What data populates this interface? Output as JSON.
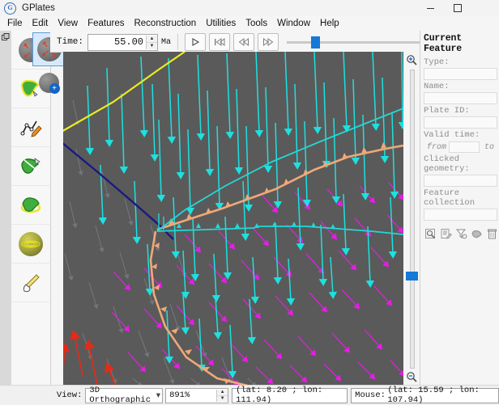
{
  "window": {
    "title": "GPlates",
    "logo_glyph": "G",
    "controls": [
      {
        "name": "minimize-button",
        "label": "–"
      },
      {
        "name": "maximize-button",
        "label": "☐"
      },
      {
        "name": "close-button",
        "label": "✕"
      }
    ]
  },
  "menubar": {
    "items": [
      {
        "label": "File"
      },
      {
        "label": "Edit"
      },
      {
        "label": "View"
      },
      {
        "label": "Features"
      },
      {
        "label": "Reconstruction"
      },
      {
        "label": "Utilities"
      },
      {
        "label": "Tools"
      },
      {
        "label": "Window"
      },
      {
        "label": "Help"
      }
    ]
  },
  "toolbar": {
    "time_label": "Time:",
    "time_value": "55.00",
    "time_unit": "Ma",
    "buttons": [
      {
        "name": "play-button",
        "icon": "play-icon"
      },
      {
        "name": "seek-start-button",
        "icon": "skip-to-start-icon"
      },
      {
        "name": "rewind-button",
        "icon": "rewind-icon"
      },
      {
        "name": "fast-forward-button",
        "icon": "fast-forward-icon"
      }
    ],
    "slider_position_pct": 16
  },
  "left_tools": {
    "dock_handle": "dock-handle-icon",
    "items": [
      {
        "name": "tool-drag-globe",
        "icon": "globe-drag-icon",
        "selected": false
      },
      {
        "name": "tool-digitise-polyline",
        "icon": "green-continent-icon",
        "selected": false
      },
      {
        "name": "tool-move-vertex",
        "icon": "move-vertex-pencil-icon",
        "selected": false
      },
      {
        "name": "tool-split-feature",
        "icon": "split-feature-icon",
        "selected": false
      },
      {
        "name": "tool-manipulate-pole",
        "icon": "manipulate-pole-icon",
        "selected": false
      },
      {
        "name": "tool-measure-distance",
        "icon": "sphere-grid-icon",
        "selected": false
      },
      {
        "name": "tool-lighting",
        "icon": "lighting-torch-icon",
        "selected": false
      }
    ],
    "flyout": [
      {
        "name": "tool-drag-globe-active",
        "icon": "globe-drag-icon",
        "selected": true
      },
      {
        "name": "tool-zoom-globe",
        "icon": "globe-zoom-icon",
        "selected": false
      }
    ]
  },
  "right_panel": {
    "title": "Current Feature",
    "fields": [
      {
        "name": "feature-type",
        "label": "Type:",
        "value": ""
      },
      {
        "name": "feature-name",
        "label": "Name:",
        "value": ""
      },
      {
        "name": "feature-plate-id",
        "label": "Plate ID:",
        "value": ""
      }
    ],
    "valid_time_label": "Valid time:",
    "valid_from_label": "from",
    "valid_to_label": "to",
    "valid_from_value": "",
    "valid_to_value": "",
    "clicked_geometry_label": "Clicked geometry:",
    "clicked_geometry_value": "",
    "feature_collection_label": "Feature collection",
    "feature_collection_value": "",
    "action_icons": [
      {
        "name": "query-feature-icon"
      },
      {
        "name": "edit-feature-icon"
      },
      {
        "name": "clone-feature-icon"
      },
      {
        "name": "copy-geometry-icon"
      },
      {
        "name": "delete-feature-icon"
      }
    ]
  },
  "canvas": {
    "zoom_in_icon": "zoom-in-magnifier-icon",
    "zoom_out_icon": "zoom-out-magnifier-icon",
    "zoom_handle_pct": 68,
    "background_color": "#5a5a5a",
    "velocity_colors": {
      "cyan": "#1ee0e0",
      "magenta": "#e81ce8",
      "grey": "#7b8088",
      "red": "#e32b18"
    },
    "feature_colors": {
      "subduction_orange": "#f0a878",
      "boundary_cyan": "#22d8d8",
      "ridge_yellow": "#ecec20",
      "trench_navy": "#1a1a82"
    }
  },
  "statusbar": {
    "view_label": "View:",
    "view_value": "3D Orthographic",
    "zoom_value": "891%",
    "centre_coords": "(lat: 8.20 ; lon: 111.94)",
    "mouse_label": "Mouse:",
    "mouse_coords": "(lat: 15.59 ; lon: 107.94)"
  }
}
